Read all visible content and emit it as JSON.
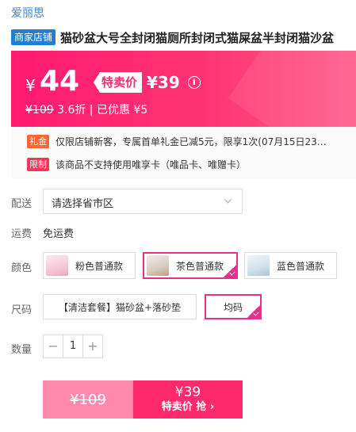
{
  "brand": "爱丽思",
  "product": {
    "shop_badge": "商家店铺",
    "title": "猫砂盆大号全封闭猫厕所封闭式猫屎盆半封闭猫沙盆"
  },
  "price": {
    "currency": "¥",
    "current": "44",
    "special_label": "特卖价",
    "special_price": "¥39",
    "info_icon": "i",
    "original": "¥109",
    "discount_text": "3.6折 | 已优惠 ¥5"
  },
  "promos": [
    {
      "tag": "礼金",
      "text": "仅限店铺新客，专属首单礼金已减5元，限享1次(07月15日23…"
    },
    {
      "tag": "限制",
      "text": "该商品不支持使用唯享卡（唯品卡、唯赠卡）"
    }
  ],
  "delivery": {
    "label": "配送",
    "placeholder": "请选择省市区"
  },
  "freight": {
    "label": "运费",
    "value": "免运费"
  },
  "color": {
    "label": "颜色",
    "options": [
      "粉色普通款",
      "茶色普通款",
      "蓝色普通款"
    ],
    "selected": "茶色普通款"
  },
  "size": {
    "label": "尺码",
    "options": [
      "【清洁套餐】猫砂盆+落砂垫",
      "均码"
    ],
    "selected": "均码"
  },
  "quantity": {
    "label": "数量",
    "minus": "−",
    "value": "1",
    "plus": "+"
  },
  "buy": {
    "original": "¥109",
    "price": "¥39",
    "action": "特卖价 抢 ›"
  },
  "colors": {
    "accent": "#ff2a6e",
    "selected_border": "#e8308a",
    "brand_blue": "#3a88d6"
  }
}
